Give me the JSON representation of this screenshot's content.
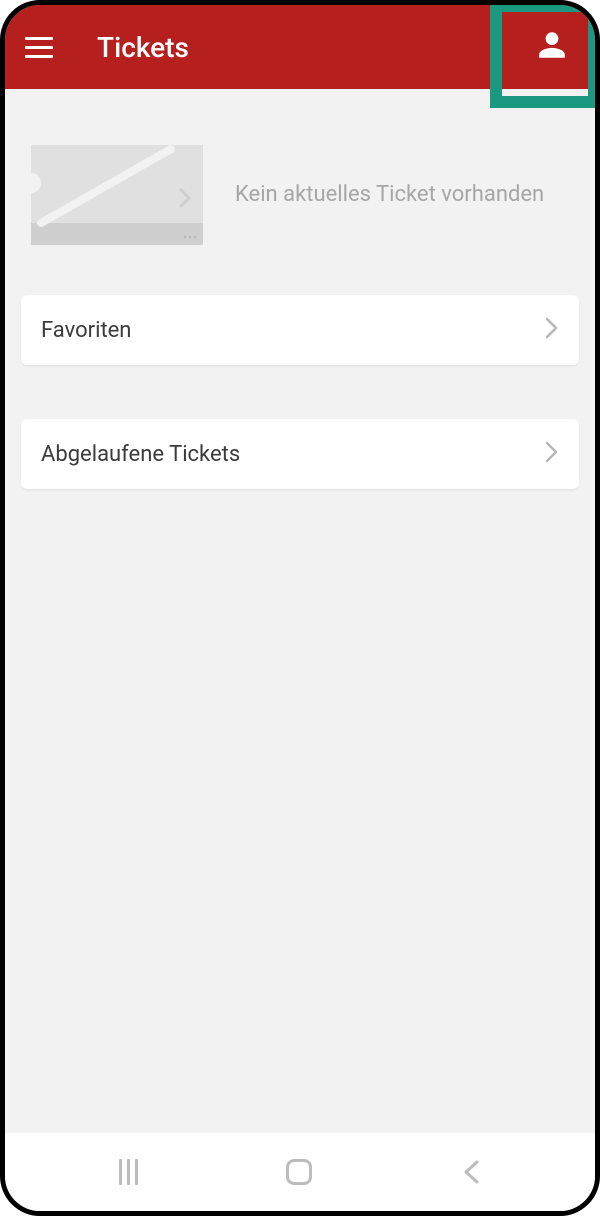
{
  "header": {
    "title": "Tickets"
  },
  "placeholder": {
    "text": "Kein aktuelles Ticket vorhanden"
  },
  "list": {
    "favorites": "Favoriten",
    "expired": "Abgelaufene Tickets"
  },
  "colors": {
    "header_bg": "#b51f1d",
    "highlight": "#1a9880"
  }
}
